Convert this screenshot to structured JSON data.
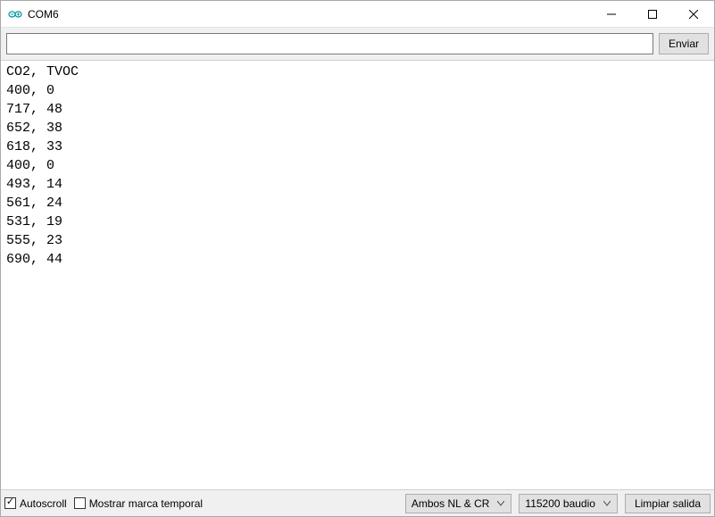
{
  "window": {
    "title": "COM6"
  },
  "toolbar": {
    "send_label": "Enviar",
    "input_value": ""
  },
  "output": {
    "header": "CO2, TVOC",
    "rows": [
      {
        "co2": 400,
        "tvoc": 0
      },
      {
        "co2": 717,
        "tvoc": 48
      },
      {
        "co2": 652,
        "tvoc": 38
      },
      {
        "co2": 618,
        "tvoc": 33
      },
      {
        "co2": 400,
        "tvoc": 0
      },
      {
        "co2": 493,
        "tvoc": 14
      },
      {
        "co2": 561,
        "tvoc": 24
      },
      {
        "co2": 531,
        "tvoc": 19
      },
      {
        "co2": 555,
        "tvoc": 23
      },
      {
        "co2": 690,
        "tvoc": 44
      }
    ]
  },
  "bottom": {
    "autoscroll_label": "Autoscroll",
    "autoscroll_checked": true,
    "timestamp_label": "Mostrar marca temporal",
    "timestamp_checked": false,
    "line_ending_selected": "Ambos NL & CR",
    "baud_selected": "115200 baudio",
    "clear_label": "Limpiar salida"
  }
}
